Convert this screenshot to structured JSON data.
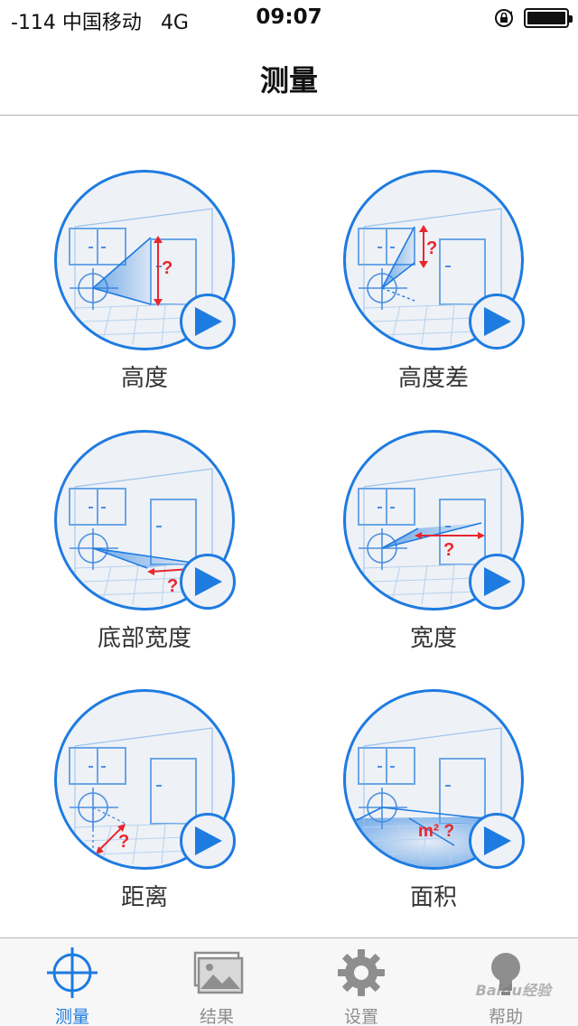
{
  "status_bar": {
    "signal": "-114 中国移动",
    "network": "4G",
    "time": "09:07"
  },
  "nav": {
    "title": "测量"
  },
  "tiles": [
    {
      "label": "高度"
    },
    {
      "label": "高度差"
    },
    {
      "label": "底部宽度"
    },
    {
      "label": "宽度"
    },
    {
      "label": "距离"
    },
    {
      "label": "面积"
    }
  ],
  "scene_marks": {
    "question": "?",
    "area": "m² ?"
  },
  "tabs": [
    {
      "label": "测量",
      "icon": "crosshair-icon",
      "active": true
    },
    {
      "label": "结果",
      "icon": "photos-icon",
      "active": false
    },
    {
      "label": "设置",
      "icon": "gear-icon",
      "active": false
    },
    {
      "label": "帮助",
      "icon": "lightbulb-icon",
      "active": false
    }
  ],
  "watermark": "Baidu经验",
  "colors": {
    "accent": "#1e7be0",
    "marker": "#e8262d",
    "tab_inactive": "#8e8e8e"
  }
}
